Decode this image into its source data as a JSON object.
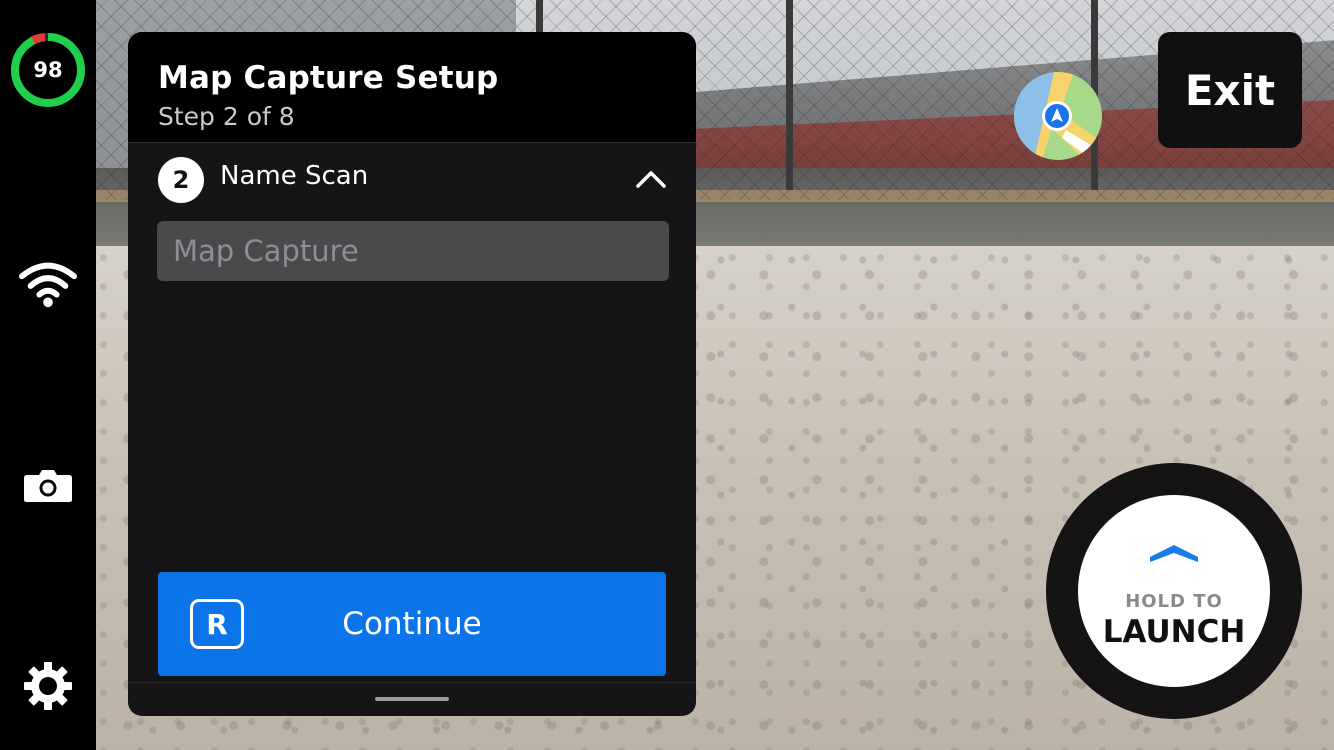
{
  "battery": {
    "level": 98,
    "level_text": "98",
    "ring_color": "#1ed04b",
    "warn_color": "#e53935"
  },
  "toolbar": {
    "icons": [
      "wifi-icon",
      "camera-icon",
      "gear-icon"
    ]
  },
  "panel": {
    "title": "Map Capture Setup",
    "step": "Step 2 of 8",
    "section": {
      "number": "2",
      "title": "Name Scan"
    },
    "name_input": {
      "value": "",
      "placeholder": "Map Capture"
    },
    "continue": {
      "key": "R",
      "label": "Continue",
      "color": "#0a74e8"
    }
  },
  "exit": {
    "label": "Exit"
  },
  "launch": {
    "hold_label": "HOLD TO",
    "label": "LAUNCH",
    "chevron_color": "#1a7de6"
  },
  "map": {
    "icon": "navigation-arrow-icon",
    "accent": "#1a73e8"
  }
}
